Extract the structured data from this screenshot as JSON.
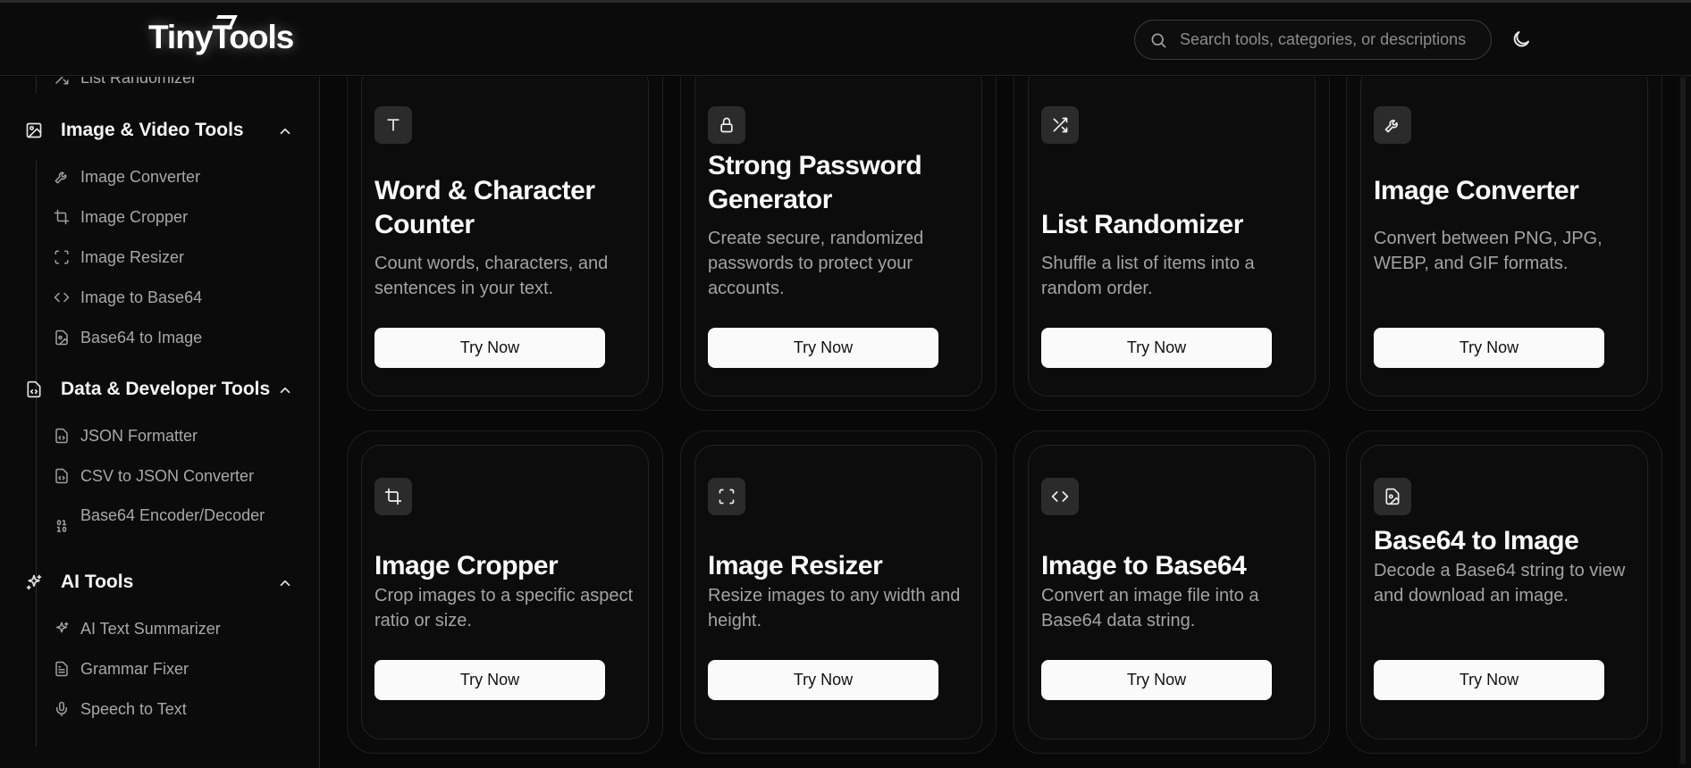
{
  "header": {
    "logo": "TinyTools",
    "search_placeholder": "Search tools, categories, or descriptions"
  },
  "sidebar": {
    "top_item": "List Randomizer",
    "groups": [
      {
        "title": "Image & Video Tools",
        "items": [
          "Image Converter",
          "Image Cropper",
          "Image Resizer",
          "Image to Base64",
          "Base64 to Image"
        ]
      },
      {
        "title": "Data & Developer Tools",
        "items": [
          "JSON Formatter",
          "CSV to JSON Converter",
          "Base64 Encoder/Decoder"
        ]
      },
      {
        "title": "AI Tools",
        "items": [
          "AI Text Summarizer",
          "Grammar Fixer",
          "Speech to Text"
        ]
      }
    ]
  },
  "cards": [
    {
      "icon": "text-type-icon",
      "title": "Word & Character Counter",
      "desc": "Count words, characters, and sentences in your text.",
      "button": "Try Now"
    },
    {
      "icon": "lock-icon",
      "title": "Strong Password Generator",
      "desc": "Create secure, randomized passwords to protect your accounts.",
      "button": "Try Now"
    },
    {
      "icon": "shuffle-icon",
      "title": "List Randomizer",
      "desc": "Shuffle a list of items into a random order.",
      "button": "Try Now"
    },
    {
      "icon": "wrench-icon",
      "title": "Image Converter",
      "desc": "Convert between PNG, JPG, WEBP, and GIF formats.",
      "button": "Try Now"
    },
    {
      "icon": "crop-icon",
      "title": "Image Cropper",
      "desc": "Crop images to a specific aspect ratio or size.",
      "button": "Try Now"
    },
    {
      "icon": "scan-icon",
      "title": "Image Resizer",
      "desc": "Resize images to any width and height.",
      "button": "Try Now"
    },
    {
      "icon": "code-icon",
      "title": "Image to Base64",
      "desc": "Convert an image file into a Base64 data string.",
      "button": "Try Now"
    },
    {
      "icon": "file-image-icon",
      "title": "Base64 to Image",
      "desc": "Decode a Base64 string to view and download an image.",
      "button": "Try Now"
    }
  ]
}
